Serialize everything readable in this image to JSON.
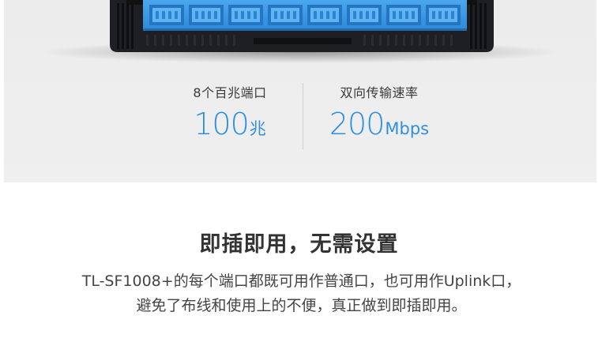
{
  "specs": {
    "ports": {
      "label": "8个百兆端口",
      "value": "100",
      "unit": "兆"
    },
    "rate": {
      "label": "双向传输速率",
      "value": "200",
      "unit": "Mbps"
    }
  },
  "feature": {
    "title": "即插即用，无需设置",
    "description": "TL-SF1008+的每个端口都既可用作普通口，也可用作Uplink口，避免了布线和使用上的不便，真正做到即插即用。"
  },
  "colors": {
    "accent": "#2f8fe0",
    "switch_body": "#1d1f22",
    "port_panel": "#3d9be6",
    "panel_background": "#ececec"
  }
}
